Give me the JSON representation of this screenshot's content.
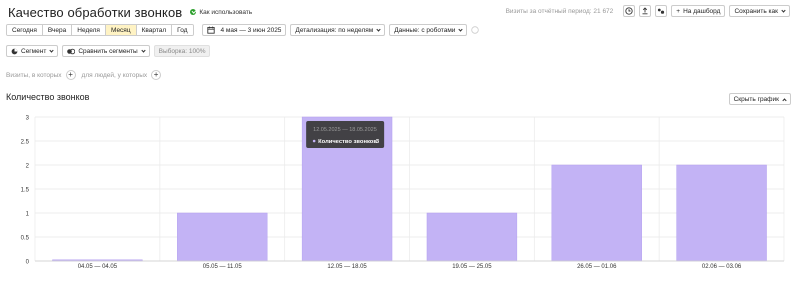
{
  "header": {
    "title": "Качество обработки звонков",
    "howto_label": "Как использовать",
    "visits_info": "Визиты за отчётный период: 21 672",
    "add_dashboard_label": "На дашборд",
    "save_as_label": "Сохранить как"
  },
  "periods": [
    "Сегодня",
    "Вчера",
    "Неделя",
    "Месяц",
    "Квартал",
    "Год"
  ],
  "active_period": "Месяц",
  "date_range": "4 мая — 3 июн 2025",
  "detail_label": "Детализация: по неделям",
  "data_label": "Данные: с роботами",
  "segment_label": "Сегмент",
  "compare_label": "Сравнить сегменты",
  "sample_label": "Выборка: 100%",
  "filter_visits_label": "Визиты, в которых",
  "filter_people_label": "для людей, у которых",
  "section_title": "Количество звонков",
  "hide_chart_label": "Скрыть график",
  "colors": {
    "bar": "#c3b3f5",
    "bar_stroke": "#b3a0f0",
    "active_period": "#fff3c4",
    "tooltip_bg": "#3b3b3b"
  },
  "tooltip": {
    "date": "12.05.2025 — 18.05.2025",
    "metric": "Количество звонков",
    "value": "3"
  },
  "chart_data": {
    "type": "bar",
    "categories": [
      "04.05 — 04.05",
      "05.05 — 11.05",
      "12.05 — 18.05",
      "19.05 — 25.05",
      "26.05 — 01.06",
      "02.06 — 03.06"
    ],
    "values": [
      0,
      1,
      3,
      1,
      2,
      2
    ],
    "yticks": [
      0,
      0.5,
      1,
      1.5,
      2,
      2.5,
      3
    ],
    "ylim": [
      0,
      3
    ],
    "grid": true,
    "series": [
      {
        "values": [
          0,
          1,
          3,
          1,
          2,
          2
        ]
      }
    ]
  }
}
